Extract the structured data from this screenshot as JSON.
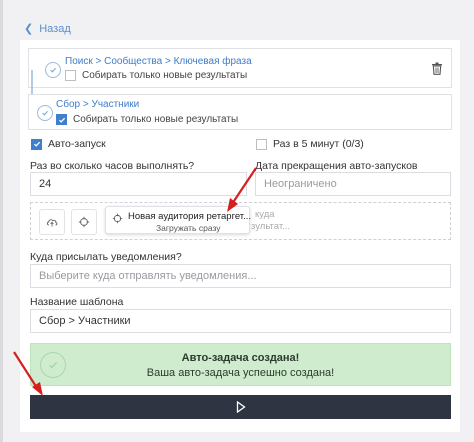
{
  "colors": {
    "accent": "#3f7fcd",
    "link": "#3e7cc8",
    "success_bg": "#cfeccf",
    "run_button": "#2e3441",
    "annotation_arrow": "#d62020"
  },
  "nav": {
    "back_label": "Назад"
  },
  "steps": [
    {
      "path": "Поиск > Сообщества > Ключевая фраза",
      "option_label": "Собирать только новые результаты",
      "option_checked": false
    },
    {
      "path": "Сбор > Участники",
      "option_label": "Собирать только новые результаты",
      "option_checked": true
    }
  ],
  "settings": {
    "autorun_label": "Авто-запуск",
    "autorun_checked": true,
    "every5_label": "Раз в 5 минут (0/3)",
    "every5_checked": false,
    "hours_label": "Раз во сколько часов выполнять?",
    "hours_value": "24",
    "stop_date_label": "Дата прекращения авто-запусков",
    "stop_date_value": "Неограничено"
  },
  "popup": {
    "title": "Новая аудитория ретаргет...",
    "subtitle": "Загружать сразу",
    "behind_text_1": "куда",
    "behind_text_2": "зультат..."
  },
  "notify": {
    "label": "Куда присылать уведомления?",
    "placeholder": "Выберите куда отправлять уведомления..."
  },
  "template": {
    "label": "Название шаблона",
    "value": "Сбор > Участники"
  },
  "alert": {
    "title": "Авто-задача создана!",
    "message": "Ваша авто-задача успешно создана!"
  },
  "icons": {
    "back": "chevron-left-icon",
    "step_status": "check-circle-icon",
    "delete": "trash-icon",
    "upload": "cloud-upload-icon",
    "target": "crosshair-icon",
    "run": "play-icon"
  }
}
